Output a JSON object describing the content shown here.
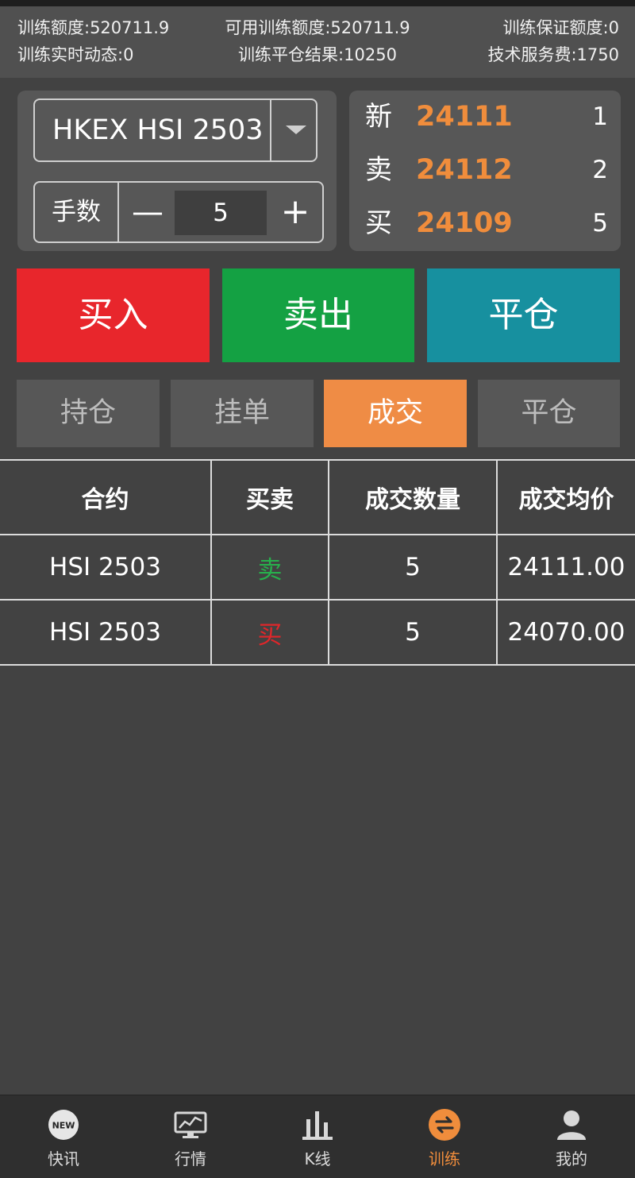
{
  "stats": {
    "train_quota": "训练额度:520711.9",
    "available_quota": "可用训练额度:520711.9",
    "margin_quota": "训练保证额度:0",
    "realtime_pnl": "训练实时动态:0",
    "close_result": "训练平仓结果:10250",
    "service_fee": "技术服务费:1750"
  },
  "order": {
    "contract": "HKEX HSI 2503",
    "lots_label": "手数",
    "lots_value": "5"
  },
  "quotes": [
    {
      "label": "新",
      "price": "24111",
      "size": "1"
    },
    {
      "label": "卖",
      "price": "24112",
      "size": "2"
    },
    {
      "label": "买",
      "price": "24109",
      "size": "5"
    }
  ],
  "actions": {
    "buy": "买入",
    "sell": "卖出",
    "close": "平仓"
  },
  "tabs": [
    {
      "label": "持仓",
      "active": false
    },
    {
      "label": "挂单",
      "active": false
    },
    {
      "label": "成交",
      "active": true
    },
    {
      "label": "平仓",
      "active": false
    }
  ],
  "table": {
    "headers": [
      "合约",
      "买卖",
      "成交数量",
      "成交均价"
    ],
    "rows": [
      {
        "contract": "HSI 2503",
        "side": "卖",
        "qty": "5",
        "price": "24111.00"
      },
      {
        "contract": "HSI 2503",
        "side": "买",
        "qty": "5",
        "price": "24070.00"
      }
    ]
  },
  "nav": [
    {
      "label": "快讯",
      "icon": "news-icon",
      "badge": "NEW"
    },
    {
      "label": "行情",
      "icon": "market-icon"
    },
    {
      "label": "K线",
      "icon": "kline-icon"
    },
    {
      "label": "训练",
      "icon": "training-icon",
      "active": true
    },
    {
      "label": "我的",
      "icon": "profile-icon"
    }
  ],
  "colors": {
    "background": "#424242",
    "buy": "#e8262c",
    "sell": "#14a143",
    "close": "#17909f",
    "accent": "#f08d3c"
  }
}
